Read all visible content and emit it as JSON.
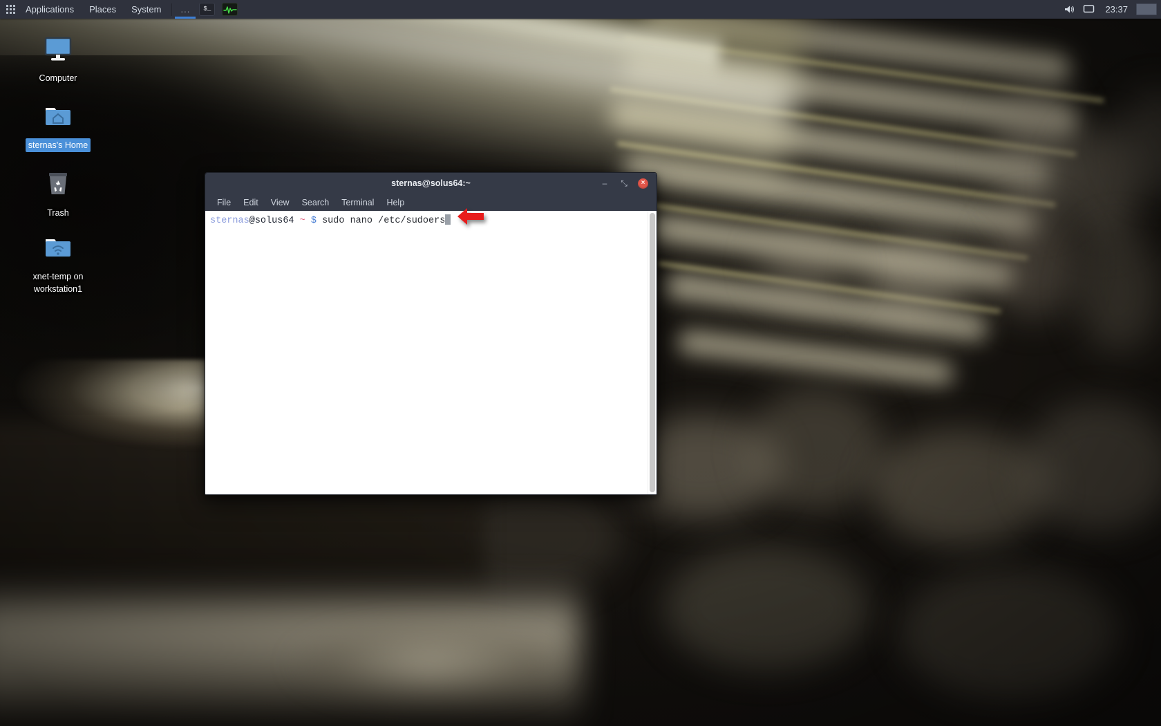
{
  "panel": {
    "app_grid_icon": "grid-dots-icon",
    "menus": [
      {
        "label": "Applications"
      },
      {
        "label": "Places"
      },
      {
        "label": "System"
      }
    ],
    "tasklist": [
      {
        "label": "...",
        "active": true
      }
    ],
    "launchers": [
      {
        "name": "terminal-launcher",
        "glyph": "$_"
      },
      {
        "name": "system-monitor-launcher",
        "glyph": "heartbeat-icon"
      }
    ],
    "tray": [
      {
        "name": "volume-icon"
      },
      {
        "name": "display-icon"
      }
    ],
    "clock": "23:37",
    "workspace_switcher": "workspace-switcher"
  },
  "desktop": {
    "icons": [
      {
        "name": "computer",
        "label": "Computer",
        "icon": "monitor-icon",
        "selected": false
      },
      {
        "name": "home",
        "label": "sternas's Home",
        "icon": "home-folder-icon",
        "selected": true
      },
      {
        "name": "trash",
        "label": "Trash",
        "icon": "trash-icon",
        "selected": false
      },
      {
        "name": "network-share",
        "label": "xnet-temp on workstation1",
        "icon": "network-folder-icon",
        "selected": false
      }
    ]
  },
  "terminal": {
    "title": "sternas@solus64:~",
    "menu": [
      {
        "label": "File"
      },
      {
        "label": "Edit"
      },
      {
        "label": "View"
      },
      {
        "label": "Search"
      },
      {
        "label": "Terminal"
      },
      {
        "label": "Help"
      }
    ],
    "window_controls": {
      "minimize": "–",
      "maximize": "⤡",
      "close": "×"
    },
    "prompt": {
      "user": "sternas",
      "host": "@solus64",
      "path": "~",
      "symbol": "$",
      "command": "sudo nano /etc/sudoers"
    }
  },
  "annotation": {
    "arrow": "red-left-arrow"
  },
  "colors": {
    "panel_bg": "#2f323d",
    "titlebar_bg": "#353a47",
    "selection_blue": "#4a90d9",
    "close_red": "#e2564a",
    "accent_blue": "#3d7fd6",
    "arrow_red": "#e81c1c",
    "terminal_bg": "#ffffff"
  }
}
